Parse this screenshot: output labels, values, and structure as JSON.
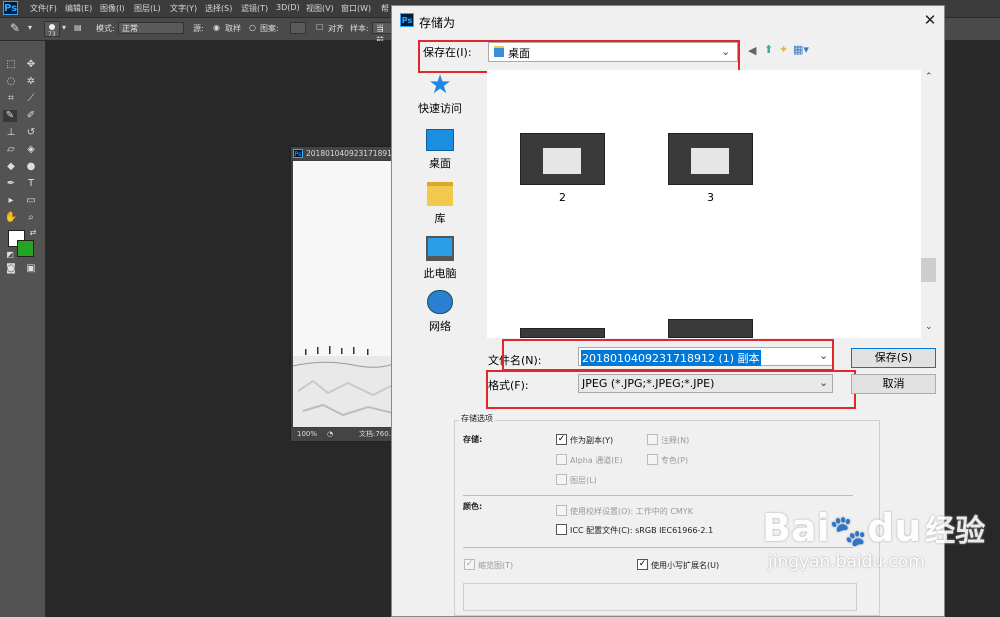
{
  "menubar": {
    "logo": "Ps",
    "items": [
      "文件(F)",
      "编辑(E)",
      "图像(I)",
      "图层(L)",
      "文字(Y)",
      "选择(S)",
      "滤镜(T)",
      "3D(D)",
      "视图(V)",
      "窗口(W)",
      "帮"
    ]
  },
  "options_bar": {
    "brush_size": "73",
    "mode_label": "模式:",
    "mode_value": "正常",
    "source_label": "源:",
    "sampled": "取样",
    "pattern": "图案:",
    "aligned": "对齐",
    "sample_label": "样本:",
    "sample_value": "当前"
  },
  "document": {
    "title": "20180104092317189​12",
    "zoom": "100%",
    "doc_info": "文档:760."
  },
  "dialog": {
    "title": "存储为",
    "save_in_label": "保存在(I):",
    "save_in_value": "桌面",
    "places": [
      {
        "label": "快速访问",
        "icon": "star-icon"
      },
      {
        "label": "桌面",
        "icon": "desktop-icon"
      },
      {
        "label": "库",
        "icon": "library-folder-icon"
      },
      {
        "label": "此电脑",
        "icon": "computer-icon"
      },
      {
        "label": "网络",
        "icon": "network-icon"
      }
    ],
    "files": [
      "2",
      "3"
    ],
    "filename_label": "文件名(N):",
    "filename_value": "20180104092317189​12 (1) 副本",
    "format_label": "格式(F):",
    "format_value": "JPEG (*.JPG;*.JPEG;*.JPE)",
    "save_button": "保存(S)",
    "cancel_button": "取消",
    "options_title": "存储选项",
    "storage_label": "存储:",
    "as_copy": "作为副本(Y)",
    "notes": "注释(N)",
    "alpha": "Alpha 通道(E)",
    "spot": "专色(P)",
    "layers": "图层(L)",
    "color_label": "颜色:",
    "use_proof": "使用校样设置(O): 工作中的 CMYK",
    "icc_profile": "ICC 配置文件(C): sRGB IEC61966-2.1",
    "thumbnail": "缩览图(T)",
    "lowercase_ext": "使用小写扩展名(U)"
  },
  "watermark": {
    "brand": "Bai",
    "brand2": "du",
    "suffix": "经验",
    "url": "jingyan.baidu.com"
  },
  "colors": {
    "highlight_red": "#e0272c",
    "selection_blue": "#0078d7",
    "ps_blue": "#31a8ff"
  }
}
